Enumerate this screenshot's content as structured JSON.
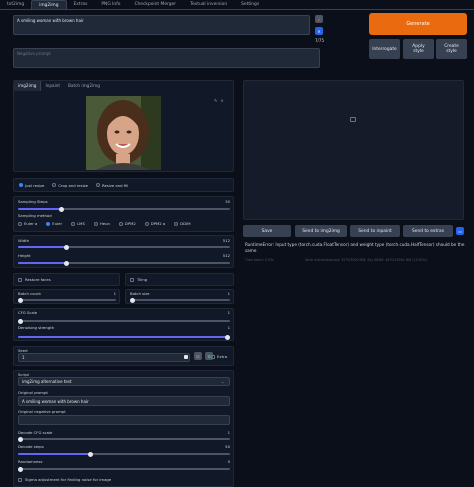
{
  "tabs": [
    "txt2img",
    "img2img",
    "Extras",
    "PNG Info",
    "Checkpoint Merger",
    "Textual inversion",
    "Settings"
  ],
  "active_tab": "img2img",
  "prompt": {
    "value": "A smiling woman with brown hair",
    "counter": "7/75",
    "negative_placeholder": "Negative prompt"
  },
  "buttons": {
    "generate": "Generate",
    "interrogate": "Interrogate",
    "apply_style": "Apply style",
    "create_style": "Create style",
    "save": "Save",
    "send_img2img": "Send to img2img",
    "send_inpaint": "Send to inpaint",
    "send_extras": "Send to extras"
  },
  "subtabs": [
    "img2img",
    "Inpaint",
    "Batch img2img"
  ],
  "resize": {
    "options": [
      "Just resize",
      "Crop and resize",
      "Resize and fill"
    ],
    "selected": 0
  },
  "sampling_steps": {
    "label": "Sampling Steps",
    "value": "30",
    "fraction": 0.2
  },
  "sampling_method": {
    "label": "Sampling method",
    "options": [
      "Euler a",
      "Euler",
      "LMS",
      "Heun",
      "DPM2",
      "DPM2 a",
      "DDIM"
    ],
    "selected": 1
  },
  "width": {
    "label": "Width",
    "value": "512",
    "fraction": 0.22
  },
  "height": {
    "label": "Height",
    "value": "512",
    "fraction": 0.22
  },
  "restore_faces": "Restore faces",
  "tiling": "Tiling",
  "batch_count": {
    "label": "Batch count",
    "value": "1",
    "fraction": 0.0
  },
  "batch_size": {
    "label": "Batch size",
    "value": "1",
    "fraction": 0.0
  },
  "cfg": {
    "label": "CFG Scale",
    "value": "1",
    "fraction": 0.0
  },
  "denoising": {
    "label": "Denoising strength",
    "value": "1",
    "fraction": 1.0
  },
  "seed": {
    "label": "Seed",
    "value": "1",
    "extra": "Extra"
  },
  "script": {
    "label": "Script",
    "value": "img2img alternative test"
  },
  "orig_prompt": {
    "label": "Original prompt",
    "value": "A smiling woman with brown hair"
  },
  "orig_neg": {
    "label": "Original negative prompt"
  },
  "decode_cfg": {
    "label": "Decode CFG scale",
    "value": "1",
    "fraction": 0.0
  },
  "decode_steps": {
    "label": "Decode steps",
    "value": "50",
    "fraction": 0.34
  },
  "randomness": {
    "label": "Randomness",
    "value": "0",
    "fraction": 0.0
  },
  "sigma": "Sigma adjustment for finding noise for image",
  "error": "RuntimeError: Input type (torch.cuda.FloatTensor) and weight type (torch.cuda.HalfTensor) should be the same",
  "time_taken": "Time taken: 0.03s",
  "torch_mem": "Torch active/reserved: 3579/3600 MiB, Sys VRAM: 4870/24564 MiB (19.83%)"
}
